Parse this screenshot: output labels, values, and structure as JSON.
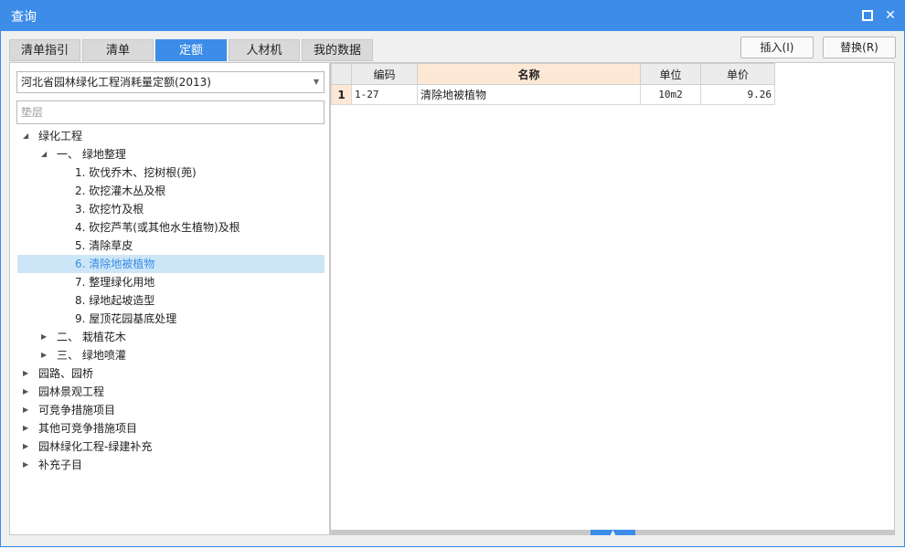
{
  "window": {
    "title": "查询"
  },
  "tabs": [
    "清单指引",
    "清单",
    "定额",
    "人材机",
    "我的数据"
  ],
  "actions": {
    "insert": "插入(I)",
    "replace": "替换(R)"
  },
  "left": {
    "database_select": "河北省园林绿化工程消耗量定额(2013)",
    "search_placeholder": "垫层",
    "tree": [
      {
        "label": "绿化工程",
        "expanded": true
      },
      {
        "label": "一、 绿地整理",
        "expanded": true
      },
      {
        "label": "1. 砍伐乔木、挖树根(蔸)"
      },
      {
        "label": "2. 砍挖灌木丛及根"
      },
      {
        "label": "3. 砍挖竹及根"
      },
      {
        "label": "4. 砍挖芦苇(或其他水生植物)及根"
      },
      {
        "label": "5. 清除草皮"
      },
      {
        "label": "6. 清除地被植物",
        "selected": true
      },
      {
        "label": "7. 整理绿化用地"
      },
      {
        "label": "8. 绿地起坡造型"
      },
      {
        "label": "9. 屋顶花园基底处理"
      },
      {
        "label": "二、 栽植花木",
        "expanded": false
      },
      {
        "label": "三、 绿地喷灌",
        "expanded": false
      },
      {
        "label": "园路、园桥",
        "expanded": false
      },
      {
        "label": "园林景观工程",
        "expanded": false
      },
      {
        "label": "可竞争措施项目",
        "expanded": false
      },
      {
        "label": "其他可竞争措施项目",
        "expanded": false
      },
      {
        "label": "园林绿化工程-绿建补充",
        "expanded": false
      },
      {
        "label": "补充子目",
        "expanded": false
      }
    ]
  },
  "grid": {
    "headers": [
      "编码",
      "名称",
      "单位",
      "单价"
    ],
    "rows": [
      {
        "num": "1",
        "code": "1-27",
        "name": "清除地被植物",
        "unit": "10m2",
        "price": "9.26"
      }
    ]
  },
  "colors": {
    "accent": "#3c8ce8",
    "selected_bg": "#cde6f7",
    "header_highlight": "#fde8d6"
  }
}
